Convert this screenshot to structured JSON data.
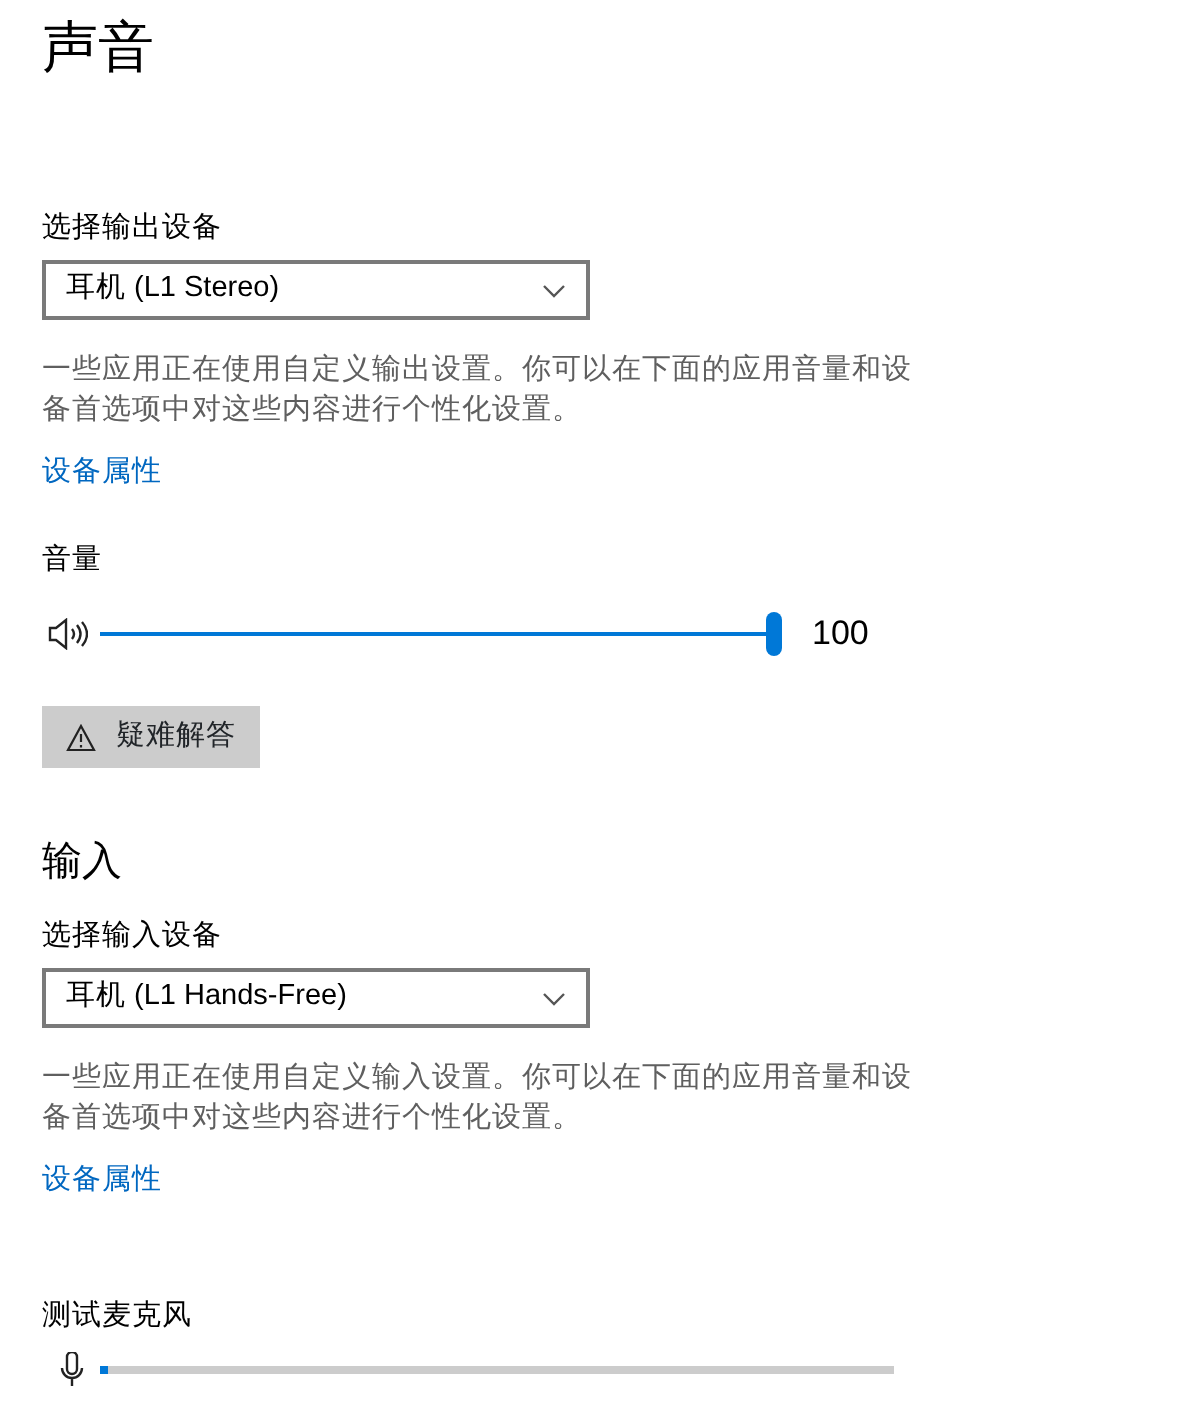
{
  "title": "声音",
  "output": {
    "label": "选择输出设备",
    "device": "耳机 (L1 Stereo)",
    "description": "一些应用正在使用自定义输出设置。你可以在下面的应用音量和设备首选项中对这些内容进行个性化设置。",
    "link": "设备属性"
  },
  "volume": {
    "label": "音量",
    "level": 1.0,
    "reading": "100"
  },
  "troubleshoot": {
    "label": "疑难解答"
  },
  "input": {
    "heading": "输入",
    "label": "选择输入设备",
    "device": "耳机 (L1 Hands-Free)",
    "description": "一些应用正在使用自定义输入设置。你可以在下面的应用音量和设备首选项中对这些内容进行个性化设置。",
    "link": "设备属性"
  },
  "mic_test": {
    "label": "测试麦克风",
    "level": 0.01
  }
}
